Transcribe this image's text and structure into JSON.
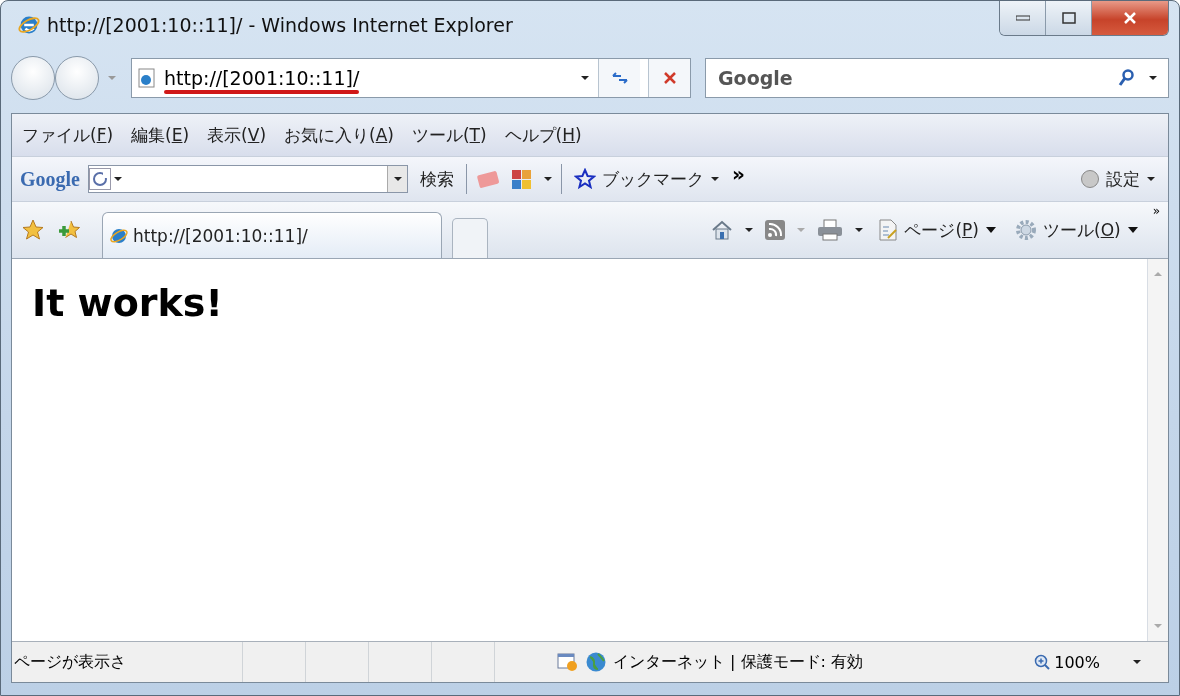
{
  "window": {
    "title": "http://[2001:10::11]/ - Windows Internet Explorer"
  },
  "address_bar": {
    "value": "http://[2001:10::11]/",
    "underlined": true
  },
  "search": {
    "placeholder": "Google"
  },
  "menu": [
    {
      "parts": [
        "ファイル(",
        "F",
        ")"
      ]
    },
    {
      "parts": [
        "編集(",
        "E",
        ")"
      ]
    },
    {
      "parts": [
        "表示(",
        "V",
        ")"
      ]
    },
    {
      "parts": [
        "お気に入り(",
        "A",
        ")"
      ]
    },
    {
      "parts": [
        "ツール(",
        "T",
        ")"
      ]
    },
    {
      "parts": [
        "ヘルプ(",
        "H",
        ")"
      ]
    }
  ],
  "google_toolbar": {
    "logo": "Google",
    "search_button": "検索",
    "bookmarks": "ブックマーク",
    "more": "»",
    "settings": "設定"
  },
  "tabs": [
    {
      "label": "http://[2001:10::11]/",
      "selected": true
    }
  ],
  "command_bar": {
    "page": [
      "ページ(",
      "P",
      ")"
    ],
    "tools": [
      "ツール(",
      "O",
      ")"
    ],
    "more": "»"
  },
  "page": {
    "heading": "It works!"
  },
  "status_bar": {
    "text": "ページが表示さ",
    "zone": "インターネット | 保護モード: 有効",
    "zoom": "100%"
  }
}
